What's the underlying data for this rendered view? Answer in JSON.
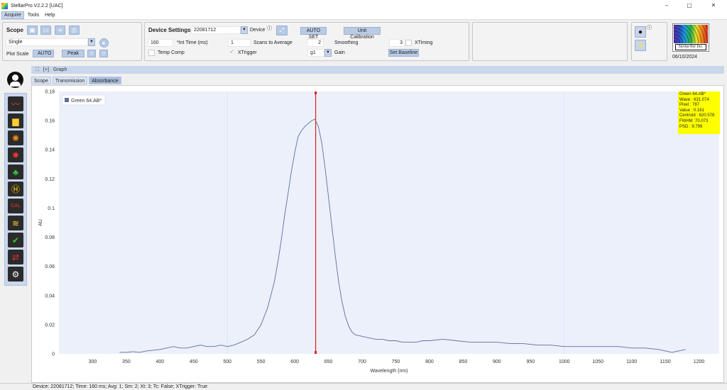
{
  "window": {
    "title": "StellarPro V2.2.2 [UAC]",
    "min": "–",
    "max": "▢",
    "close": "✕"
  },
  "menu": [
    "Acquire",
    "Tools",
    "Help"
  ],
  "scope": {
    "title": "Scope",
    "mode": "Single",
    "plot_scale_label": "Plot Scale",
    "auto_label": "AUTO",
    "peak_label": "Peak"
  },
  "device_settings": {
    "title": "Device Settings",
    "device_id": "22081712",
    "device_label": "Device",
    "int_time_value": "160",
    "int_time_label": "*Int Time (ms)",
    "temp_comp_label": "Temp Comp",
    "scans_value": "1",
    "scans_label": "Scans to Average",
    "xtrigger_label": "XTrigger",
    "auto_set_label": "AUTO SET",
    "smoothing_value": "2",
    "smoothing_label": "Smoothing",
    "gain_value": "g1",
    "gain_label": "Gain",
    "unit_calibration_label": "Unit Calibration",
    "xtiming_value": "3",
    "xtiming_label": "XTiming",
    "set_baseline_label": "Set Baseline"
  },
  "logo": {
    "brand": "StellarNet Inc.",
    "date": "06/10/2024"
  },
  "graph": {
    "header_label": "Graph",
    "tabs": [
      "Scope",
      "Transmission",
      "Absorbance"
    ],
    "active_tab": "Absorbance"
  },
  "readout": [
    "Green 64.AB*",
    "Wave : 631.074",
    "Pixel : 787",
    "Value : 0.161",
    "Centroid : 620.578",
    "FWHM :70.073",
    "PSD : 9.799"
  ],
  "status": "Device: 22081712; Time: 160 ms; Avg: 1; Sm: 2; Xt: 3; Tc: False; XTrigger: True",
  "colors": {
    "accent": "#b9cbe5",
    "plot_bg": "#ecf0fb",
    "series": "#5b6f9c",
    "cursor": "#e02020",
    "readout_bg": "#ffff00"
  },
  "chart_data": {
    "type": "line",
    "xlabel": "Wavelength (nm)",
    "ylabel": "AU",
    "xlim": [
      250,
      1230
    ],
    "ylim": [
      0,
      0.18
    ],
    "xticks": [
      300,
      350,
      400,
      450,
      500,
      550,
      600,
      650,
      700,
      750,
      800,
      850,
      900,
      950,
      1000,
      1050,
      1100,
      1150,
      1200
    ],
    "yticks": [
      0,
      0.02,
      0.04,
      0.06,
      0.08,
      0.1,
      0.12,
      0.14,
      0.16,
      0.18
    ],
    "legend": "top-left",
    "cursor_x": 631.074,
    "series": [
      {
        "name": "Green 64.AB*",
        "x": [
          340,
          350,
          360,
          370,
          380,
          390,
          400,
          410,
          420,
          430,
          440,
          450,
          460,
          470,
          480,
          490,
          500,
          510,
          520,
          530,
          540,
          550,
          560,
          570,
          575,
          580,
          585,
          590,
          595,
          600,
          605,
          610,
          615,
          620,
          625,
          630,
          635,
          640,
          645,
          650,
          655,
          660,
          665,
          670,
          675,
          680,
          685,
          690,
          700,
          710,
          720,
          730,
          740,
          750,
          760,
          770,
          780,
          790,
          800,
          820,
          840,
          860,
          880,
          900,
          920,
          940,
          960,
          980,
          1000,
          1020,
          1040,
          1060,
          1080,
          1100,
          1120,
          1140,
          1150,
          1160,
          1170,
          1180
        ],
        "y": [
          0.001,
          0.001,
          0.0015,
          0.001,
          0.002,
          0.0025,
          0.003,
          0.004,
          0.005,
          0.004,
          0.004,
          0.005,
          0.006,
          0.005,
          0.005,
          0.006,
          0.005,
          0.006,
          0.008,
          0.01,
          0.013,
          0.02,
          0.032,
          0.05,
          0.063,
          0.078,
          0.095,
          0.11,
          0.125,
          0.138,
          0.149,
          0.153,
          0.156,
          0.158,
          0.16,
          0.161,
          0.156,
          0.145,
          0.128,
          0.108,
          0.088,
          0.068,
          0.05,
          0.036,
          0.026,
          0.019,
          0.015,
          0.013,
          0.012,
          0.011,
          0.01,
          0.01,
          0.009,
          0.009,
          0.008,
          0.008,
          0.008,
          0.009,
          0.009,
          0.01,
          0.009,
          0.008,
          0.008,
          0.008,
          0.007,
          0.007,
          0.006,
          0.006,
          0.005,
          0.005,
          0.005,
          0.005,
          0.005,
          0.004,
          0.004,
          0.003,
          0.002,
          0.001,
          0.002,
          0.003
        ]
      }
    ]
  }
}
